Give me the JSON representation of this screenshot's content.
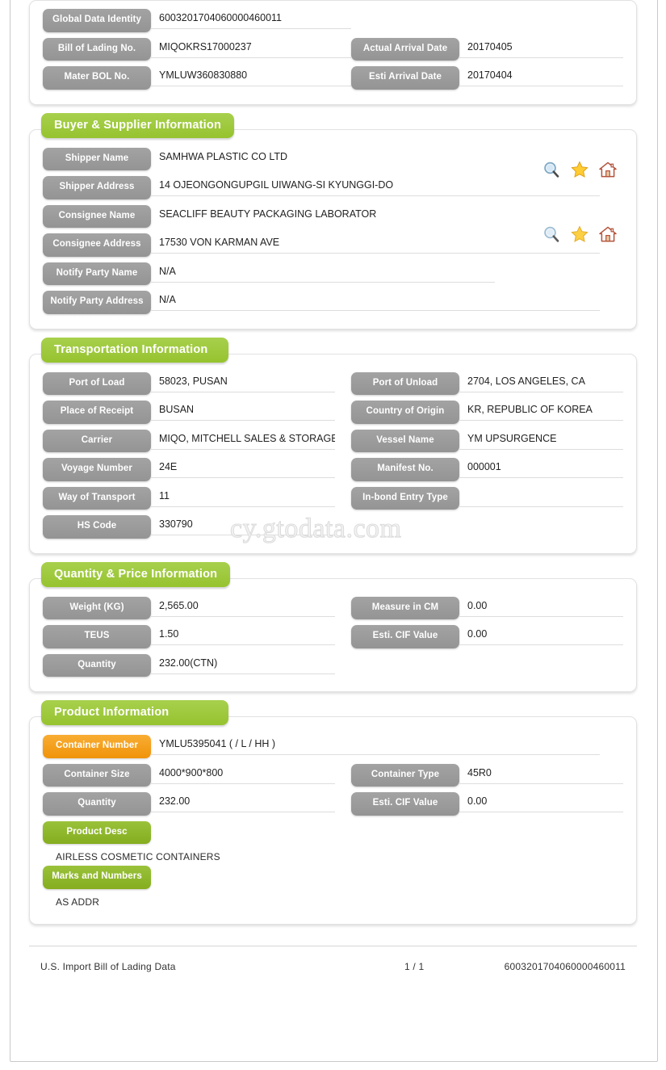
{
  "watermark": "cy.gtodata.com",
  "icons": {
    "search": "search-icon",
    "star": "star-icon",
    "home": "home-icon"
  },
  "header_card": {
    "fields": [
      {
        "label": "Global Data Identity",
        "value": "6003201704060000460011"
      },
      {
        "label": "Bill of Lading No.",
        "value": "MIQOKRS17000237"
      },
      {
        "label": "Mater BOL No.",
        "value": "YMLUW360830880"
      }
    ],
    "right_fields": [
      {
        "label": "Actual Arrival Date",
        "value": "20170405"
      },
      {
        "label": "Esti Arrival Date",
        "value": "20170404"
      }
    ]
  },
  "buyer_supplier": {
    "title": "Buyer & Supplier Information",
    "fields": [
      {
        "label": "Shipper Name",
        "value": "SAMHWA PLASTIC CO LTD"
      },
      {
        "label": "Shipper Address",
        "value": "14 OJEONGONGUPGIL UIWANG-SI KYUNGGI-DO"
      },
      {
        "label": "Consignee Name",
        "value": "SEACLIFF BEAUTY PACKAGING LABORATOR"
      },
      {
        "label": "Consignee Address",
        "value": "17530 VON KARMAN AVE"
      },
      {
        "label": "Notify Party Name",
        "value": "N/A"
      },
      {
        "label": "Notify Party Address",
        "value": "N/A"
      }
    ]
  },
  "transportation": {
    "title": "Transportation Information",
    "rows": [
      {
        "left": {
          "label": "Port of Load",
          "value": "58023, PUSAN"
        },
        "right": {
          "label": "Port of Unload",
          "value": "2704, LOS ANGELES, CA"
        }
      },
      {
        "left": {
          "label": "Place of Receipt",
          "value": "BUSAN"
        },
        "right": {
          "label": "Country of Origin",
          "value": "KR, REPUBLIC OF KOREA"
        }
      },
      {
        "left": {
          "label": "Carrier",
          "value": "MIQO, MITCHELL SALES & STORAGE I"
        },
        "right": {
          "label": "Vessel Name",
          "value": "YM UPSURGENCE"
        }
      },
      {
        "left": {
          "label": "Voyage Number",
          "value": "24E"
        },
        "right": {
          "label": "Manifest No.",
          "value": "000001"
        }
      },
      {
        "left": {
          "label": "Way of Transport",
          "value": "11"
        },
        "right": {
          "label": "In-bond Entry Type",
          "value": ""
        }
      },
      {
        "left": {
          "label": "HS Code",
          "value": "330790"
        },
        "right": {
          "label": "",
          "value": ""
        }
      }
    ]
  },
  "quantity_price": {
    "title": "Quantity & Price Information",
    "rows": [
      {
        "left": {
          "label": "Weight (KG)",
          "value": "2,565.00"
        },
        "right": {
          "label": "Measure in CM",
          "value": "0.00"
        }
      },
      {
        "left": {
          "label": "TEUS",
          "value": "1.50"
        },
        "right": {
          "label": "Esti. CIF Value",
          "value": "0.00"
        }
      },
      {
        "left": {
          "label": "Quantity",
          "value": "232.00(CTN)"
        },
        "right": {
          "label": "",
          "value": ""
        }
      }
    ]
  },
  "product": {
    "title": "Product Information",
    "container_number": {
      "label": "Container Number",
      "value": "YMLU5395041 ( / L / HH )"
    },
    "rows": [
      {
        "left": {
          "label": "Container Size",
          "value": "4000*900*800"
        },
        "right": {
          "label": "Container Type",
          "value": "45R0"
        }
      },
      {
        "left": {
          "label": "Quantity",
          "value": "232.00"
        },
        "right": {
          "label": "Esti. CIF Value",
          "value": "0.00"
        }
      }
    ],
    "product_desc": {
      "label": "Product Desc",
      "text": "AIRLESS COSMETIC CONTAINERS"
    },
    "marks_numbers": {
      "label": "Marks and Numbers",
      "text": "AS ADDR"
    }
  },
  "footer": {
    "left": "U.S. Import Bill of Lading Data",
    "middle": "1 / 1",
    "right": "6003201704060000460011"
  },
  "colors": {
    "section_green": "#a0cb3f",
    "label_gray": "#9b9b9b",
    "label_orange": "#f5a01c",
    "label_green": "#8fb92b"
  }
}
